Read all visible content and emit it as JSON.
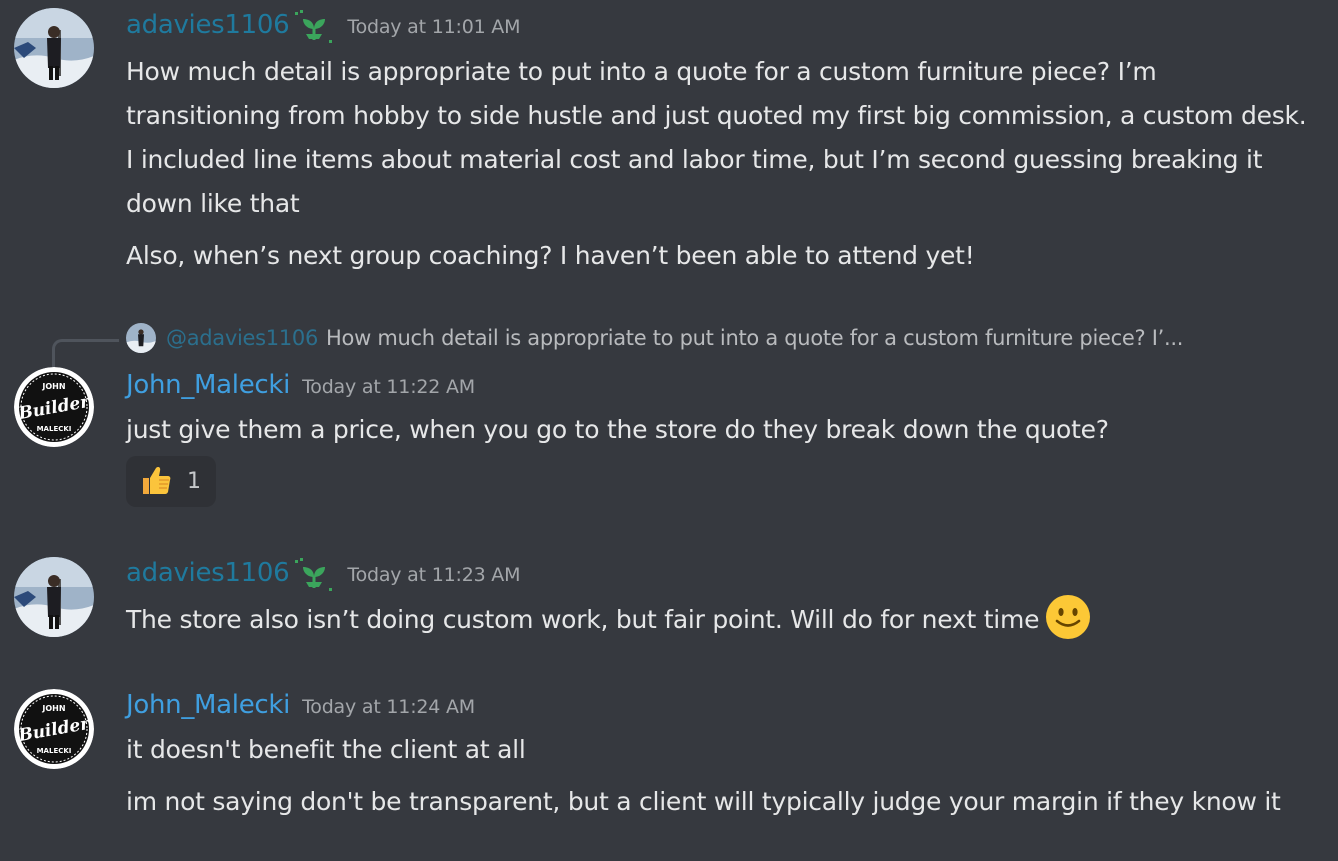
{
  "messages": [
    {
      "username": "adavies1106",
      "timestamp": "Today at 11:01 AM",
      "badge_icon": "seedling-icon",
      "paragraphs": [
        "How much detail is appropriate to put into a quote for a custom furniture piece? I’m transitioning from hobby to side hustle and just quoted my first big commission, a custom desk. I included line items about material cost and labor time, but I’m second guessing breaking it down like that",
        "Also, when’s next group coaching? I haven’t been able to attend yet!"
      ]
    },
    {
      "username": "John_Malecki",
      "timestamp": "Today at 11:22 AM",
      "reply": {
        "mention": "@adavies1106",
        "preview": "How much detail is appropriate to put into a quote for a custom furniture piece? I’..."
      },
      "paragraphs": [
        "just give them a price, when you go to the store do they break down the quote?"
      ],
      "reaction": {
        "emoji": "thumbs-up-icon",
        "count": "1"
      }
    },
    {
      "username": "adavies1106",
      "timestamp": "Today at 11:23 AM",
      "badge_icon": "seedling-icon",
      "paragraphs": [
        "The store also isn’t doing custom work, but fair point. Will do for next time"
      ],
      "trailing_emoji": "slightly-smiling-face-icon"
    },
    {
      "username": "John_Malecki",
      "timestamp": "Today at 11:24 AM",
      "paragraphs": [
        "it doesn't benefit the client at all",
        "im not saying don't be transparent, but a client will typically judge your margin if they know it"
      ]
    }
  ],
  "avatars": {
    "john_logo_top": "JOHN",
    "john_logo_main": "Builder",
    "john_logo_bottom": "MALECKI"
  },
  "colors": {
    "background": "#36393f",
    "adavies_name": "#1f7a9e",
    "john_name": "#3f9fe0",
    "timestamp": "#a3a6aa",
    "message_text": "#e6e7e8",
    "badge_green": "#3ba55c"
  }
}
